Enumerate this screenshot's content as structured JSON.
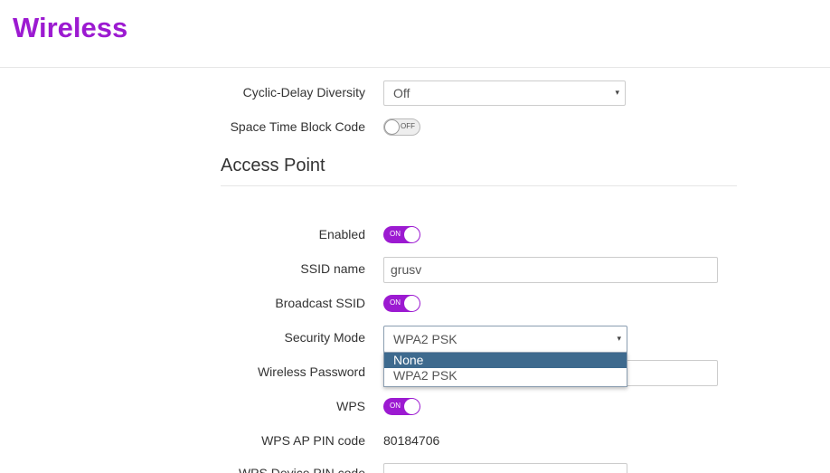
{
  "header": {
    "title": "Wireless"
  },
  "radio": {
    "cdd": {
      "label": "Cyclic-Delay Diversity",
      "value": "Off"
    },
    "stbc": {
      "label": "Space Time Block Code",
      "toggle": "OFF"
    }
  },
  "access_point": {
    "title": "Access Point",
    "enabled": {
      "label": "Enabled",
      "toggle": "ON"
    },
    "ssid": {
      "label": "SSID name",
      "value": "grusv"
    },
    "broadcast": {
      "label": "Broadcast SSID",
      "toggle": "ON"
    },
    "security": {
      "label": "Security Mode",
      "value": "WPA2 PSK",
      "options": [
        "None",
        "WPA2 PSK"
      ]
    },
    "password": {
      "label": "Wireless Password",
      "value": ""
    },
    "wps": {
      "label": "WPS",
      "toggle": "ON"
    },
    "wps_ap_pin": {
      "label": "WPS AP PIN code",
      "value": "80184706"
    },
    "wps_device_pin": {
      "label": "WPS Device PIN code",
      "value": ""
    }
  },
  "icons": {
    "select_arrow": "▾"
  },
  "colors": {
    "brand": "#9c1ad1",
    "highlight": "#3e6a8e"
  }
}
